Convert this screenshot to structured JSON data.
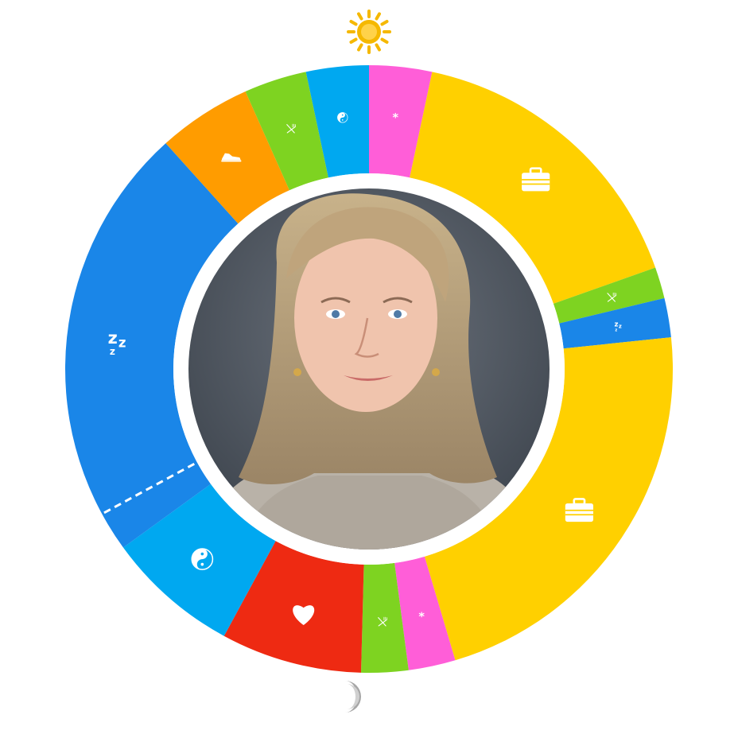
{
  "clock_markers": {
    "top": {
      "icon": "sun-icon",
      "color": "#f5b800"
    },
    "bottom": {
      "icon": "moon-icon",
      "color": "#a6a6a6"
    }
  },
  "photo": {
    "subject": "portrait-photo",
    "border_color": "#ffffff"
  },
  "categories": {
    "sleep": {
      "icon": "sleep-icon",
      "color": "#1a86e8"
    },
    "exercise": {
      "icon": "sneaker-icon",
      "color": "#ff9c00"
    },
    "meal": {
      "icon": "fork-knife-icon",
      "color": "#7ed321"
    },
    "balance": {
      "icon": "yin-yang-icon",
      "color": "#00a8f0"
    },
    "misc": {
      "icon": "asterisk-icon",
      "color": "#ff5ed8"
    },
    "work": {
      "icon": "briefcase-icon",
      "color": "#ffd000"
    },
    "family": {
      "icon": "heart-icon",
      "color": "#ee2a12"
    }
  },
  "chart_data": {
    "type": "pie",
    "variant": "donut-24h-clock",
    "start_at": "top",
    "direction": "clockwise",
    "segments": [
      {
        "category": "balance",
        "start_hour": 23.2,
        "end_hour": 0.0
      },
      {
        "category": "misc",
        "start_hour": 0.0,
        "end_hour": 0.8
      },
      {
        "category": "work",
        "start_hour": 0.8,
        "end_hour": 4.7
      },
      {
        "category": "meal",
        "start_hour": 4.7,
        "end_hour": 5.1
      },
      {
        "category": "sleep",
        "start_hour": 5.1,
        "end_hour": 5.6
      },
      {
        "category": "work",
        "start_hour": 5.6,
        "end_hour": 10.9
      },
      {
        "category": "misc",
        "start_hour": 10.9,
        "end_hour": 11.5
      },
      {
        "category": "meal",
        "start_hour": 11.5,
        "end_hour": 12.1
      },
      {
        "category": "family",
        "start_hour": 12.1,
        "end_hour": 13.9
      },
      {
        "category": "balance",
        "start_hour": 13.9,
        "end_hour": 15.6
      },
      {
        "category": "sleep",
        "start_hour": 15.6,
        "end_hour": 21.2
      },
      {
        "category": "exercise",
        "start_hour": 21.2,
        "end_hour": 22.4
      },
      {
        "category": "meal",
        "start_hour": 22.4,
        "end_hour": 23.2
      }
    ],
    "dashed_divider_hour": 16.1
  }
}
